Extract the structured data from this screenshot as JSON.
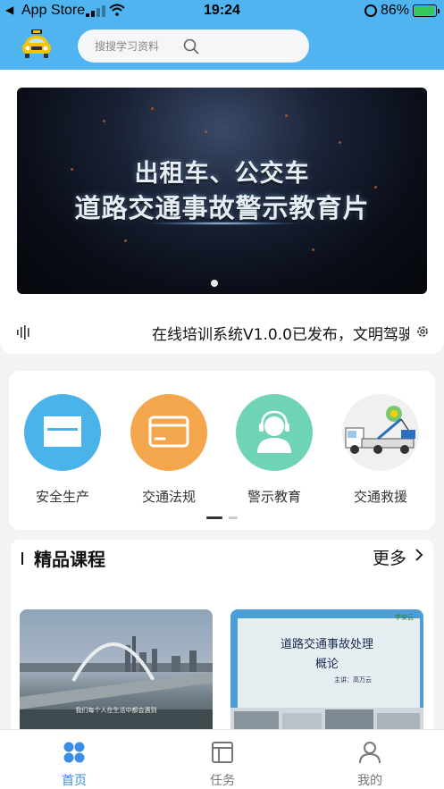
{
  "status_bar": {
    "carrier": "App Store",
    "time": "19:24",
    "battery_percent": "86%",
    "battery_level": 0.86,
    "battery_color": "#34c759"
  },
  "header": {
    "accent": "#4fb4f0",
    "logo_icon": "taxi-logo-icon",
    "search": {
      "placeholder": "搜搜学习资料",
      "icon": "search-icon"
    }
  },
  "banner": {
    "line1": "出租车、公交车",
    "line2": "道路交通事故警示教育片",
    "pages": 1,
    "current_page": 1
  },
  "notice": {
    "icon": "audio-wave-icon",
    "text": "在线培训系统V1.0.0已发布，文明驾驶",
    "settings_icon": "gear-icon"
  },
  "categories": [
    {
      "label": "安全生产",
      "icon": "storefront-icon",
      "color": "#4ab3ea"
    },
    {
      "label": "交通法规",
      "icon": "card-icon",
      "color": "#f3a64b"
    },
    {
      "label": "警示教育",
      "icon": "person-headset-icon",
      "color": "#6fd3b5"
    },
    {
      "label": "交通救援",
      "icon": "tow-truck-icon",
      "color": "#f0f0f0"
    }
  ],
  "category_pager": {
    "pages": 2,
    "current_page": 1
  },
  "courses": {
    "title": "精品课程",
    "more_label": "更多",
    "items": [
      {
        "caption": "我们每个人在生活中都会遇到"
      },
      {
        "title_line1": "道路交通事故处理",
        "title_line2": "概论",
        "lecturer": "主讲：高万云",
        "logo_text": "学安云"
      }
    ]
  },
  "tabbar": {
    "active_color": "#3a8ee6",
    "inactive_color": "#777777",
    "tabs": [
      {
        "label": "首页",
        "icon": "home-grid-icon",
        "active": true
      },
      {
        "label": "任务",
        "icon": "task-board-icon",
        "active": false
      },
      {
        "label": "我的",
        "icon": "profile-icon",
        "active": false
      }
    ]
  }
}
